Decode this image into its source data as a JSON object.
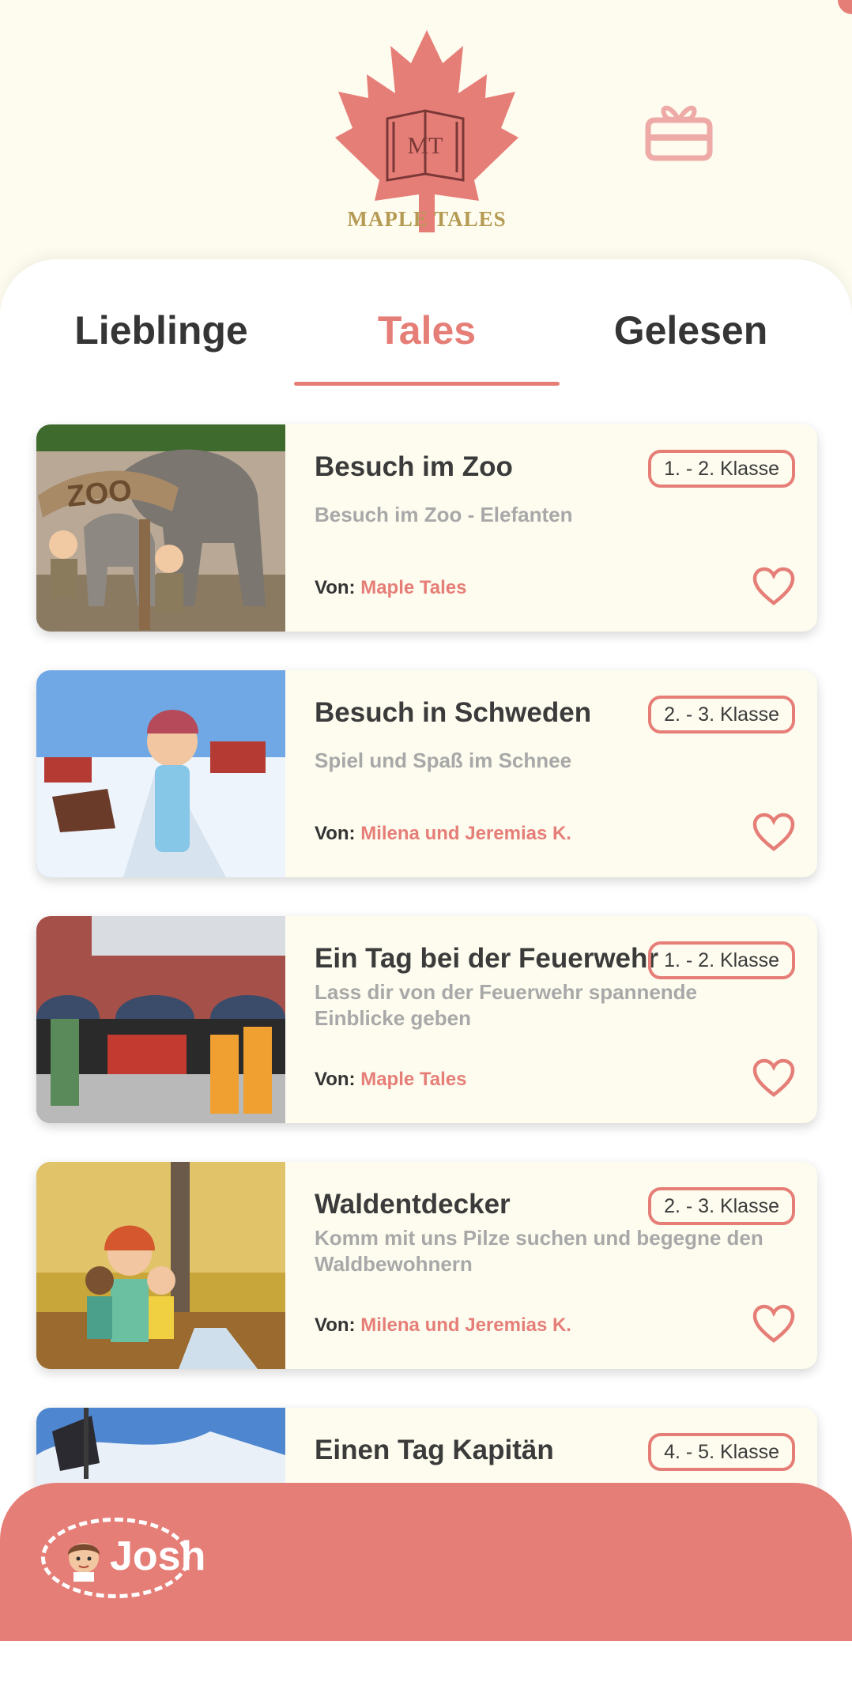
{
  "app": {
    "logo_text": "MAPLE TALES",
    "logo_monogram": "MT"
  },
  "colors": {
    "accent": "#e67e78",
    "background": "#fdfcef",
    "logo_gold": "#b59a53"
  },
  "icons": {
    "gift": "gift-icon",
    "favorite": "heart-outline-icon"
  },
  "tabs": [
    {
      "label": "Lieblinge",
      "active": false
    },
    {
      "label": "Tales",
      "active": true
    },
    {
      "label": "Gelesen",
      "active": false
    }
  ],
  "stories": [
    {
      "title": "Besuch im Zoo",
      "subtitle": "Besuch im Zoo - Elefanten",
      "grade": "1. - 2. Klasse",
      "author_prefix": "Von:",
      "author": "Maple Tales",
      "image_text": "ZOO"
    },
    {
      "title": "Besuch in Schweden",
      "subtitle": "Spiel und Spaß im Schnee",
      "grade": "2. - 3. Klasse",
      "author_prefix": "Von:",
      "author": "Milena und Jeremias K."
    },
    {
      "title": "Ein Tag bei der Feuerwehr",
      "subtitle": "Lass dir von der Feuerwehr spannende Einblicke geben",
      "grade": "1. - 2. Klasse",
      "author_prefix": "Von:",
      "author": "Maple Tales"
    },
    {
      "title": "Waldentdecker",
      "subtitle": "Komm mit uns Pilze suchen und begegne den Waldbewohnern",
      "grade": "2. - 3. Klasse",
      "author_prefix": "Von:",
      "author": "Milena und Jeremias K."
    },
    {
      "title": "Einen Tag Kapitän",
      "grade": "4. - 5. Klasse"
    }
  ],
  "profile": {
    "name": "Josh"
  }
}
